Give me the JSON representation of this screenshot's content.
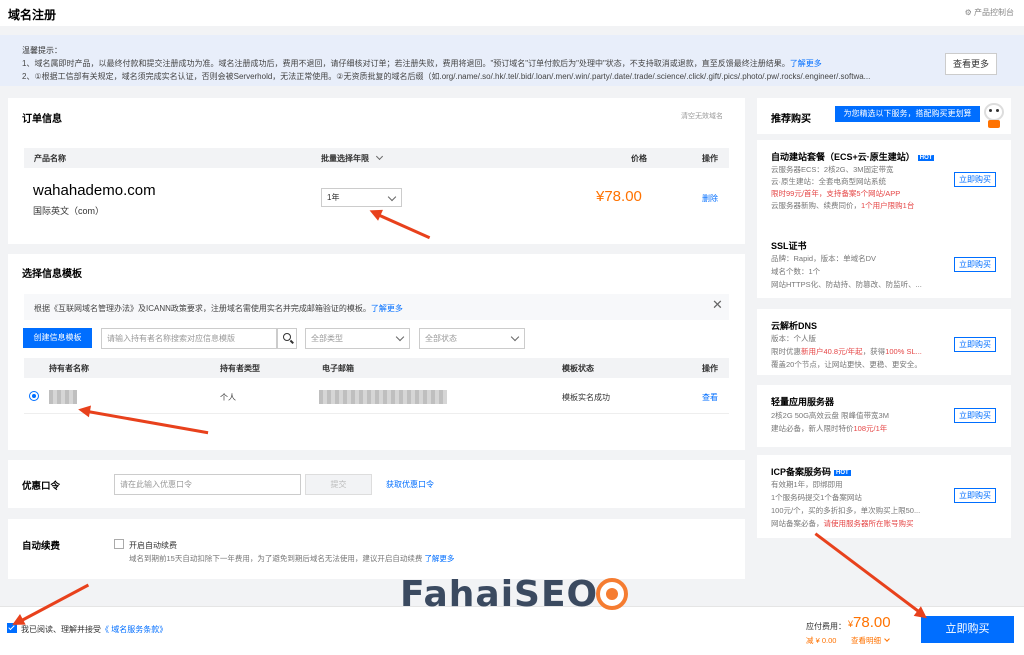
{
  "header": {
    "title": "域名注册",
    "console": "产品控制台"
  },
  "notice": {
    "title": "温馨提示：",
    "line1": "1、域名属即时产品，以最终付款和提交注册成功为准。域名注册成功后，费用不退回，请仔细核对订单；若注册失败，费用将退回。\"预订域名\"订单付款后为\"处理中\"状态，不支持取消或退款，直至反馈最终注册结果。",
    "line1_link": "了解更多",
    "line2": "2、①根据工信部有关规定，域名须完成实名认证，否则会被Serverhold，无法正常使用。②无资质批复的域名后缀（如.org/.name/.so/.hk/.tel/.bid/.loan/.men/.win/.party/.date/.trade/.science/.click/.gift/.pics/.photo/.pw/.rocks/.engineer/.softwa...",
    "more_button": "查看更多"
  },
  "order": {
    "title": "订单信息",
    "clear_invalid": "清空无效域名",
    "col_name": "产品名称",
    "col_years": "批量选择年限",
    "col_price": "价格",
    "col_action": "操作",
    "domain": "wahahademo.com",
    "domain_type": "国际英文（com）",
    "years_value": "1年",
    "price": "¥78.00",
    "delete": "删除"
  },
  "template": {
    "title": "选择信息模板",
    "info": "根据《互联网域名管理办法》及ICANN政策要求，注册域名需使用实名并完成邮箱验证的模板。",
    "info_link": "了解更多",
    "create_button": "创建信息模板",
    "search_placeholder": "请输入持有者名称搜索对应信息模版",
    "type_select": "全部类型",
    "status_select": "全部状态",
    "col_holder": "持有者名称",
    "col_type": "持有者类型",
    "col_email": "电子邮箱",
    "col_status": "模板状态",
    "col_action": "操作",
    "row_type": "个人",
    "row_status": "模板实名成功",
    "row_action": "查看"
  },
  "coupon": {
    "label": "优惠口令",
    "placeholder": "请在此输入优惠口令",
    "submit": "提交",
    "get_link": "获取优惠口令"
  },
  "renew": {
    "label": "自动续费",
    "checkbox_label": "开启自动续费",
    "desc": "域名到期前15天自动扣除下一年费用，为了避免到期后域名无法使用，建议开启自动续费",
    "link": "了解更多"
  },
  "recommend": {
    "title": "推荐购买",
    "banner": "为您精选以下服务，搭配购买更划算",
    "buy_label": "立即购买",
    "items": [
      {
        "name": "自动建站套餐（ECS+云·原生建站）",
        "hot": "HOT",
        "d1": "云服务器ECS：2核2G、3M固定带宽",
        "d2": "云·原生建站：全套电商型网站系统",
        "d3a": "限时99元/首年，支持",
        "d3b": "备案5个网站/APP",
        "d4a": "云服务器新购、续费同价，",
        "d4b": "1个用户限购1台"
      },
      {
        "name": "SSL证书",
        "d1": "品牌：Rapid，版本：单域名DV",
        "d2": "域名个数：1个",
        "d3": "网站HTTPS化、防劫持、防篡改、防监听、..."
      },
      {
        "name": "云解析DNS",
        "d1": "版本：个人版",
        "d2a": "限时优惠",
        "d2b": "新用户40.8元/年起",
        "d2c": "，获得",
        "d2d": "100% SL...",
        "d3": "覆盖20个节点，让网站更快、更稳、更安全。"
      },
      {
        "name": "轻量应用服务器",
        "d1": "2核2G 50G高效云盘 限峰值带宽3M",
        "d2a": "建站必备，新人限时特价",
        "d2b": "108元/1年"
      },
      {
        "name": "ICP备案服务码",
        "hot": "HOT",
        "d1": "有效期1年，即绑即用",
        "d2": "1个服务码提交1个备案网站",
        "d3": "100元/个，买的多折扣多，单次购买上限50...",
        "d4a": "网站备案必备，",
        "d4b": "请使用服务器所在账号购买"
      }
    ]
  },
  "footer": {
    "agree": "我已阅读、理解并接受",
    "terms": "《 域名服务条款》",
    "total_label": "应付费用：",
    "total_currency": "¥",
    "total": "78.00",
    "discount": "减 ¥ 0.00",
    "detail": "查看明细",
    "buy": "立即购买"
  },
  "watermark": "FahaiSEO",
  "colors": {
    "accent": "#006eff",
    "price": "#ff7200",
    "arrow": "#e8411c"
  }
}
